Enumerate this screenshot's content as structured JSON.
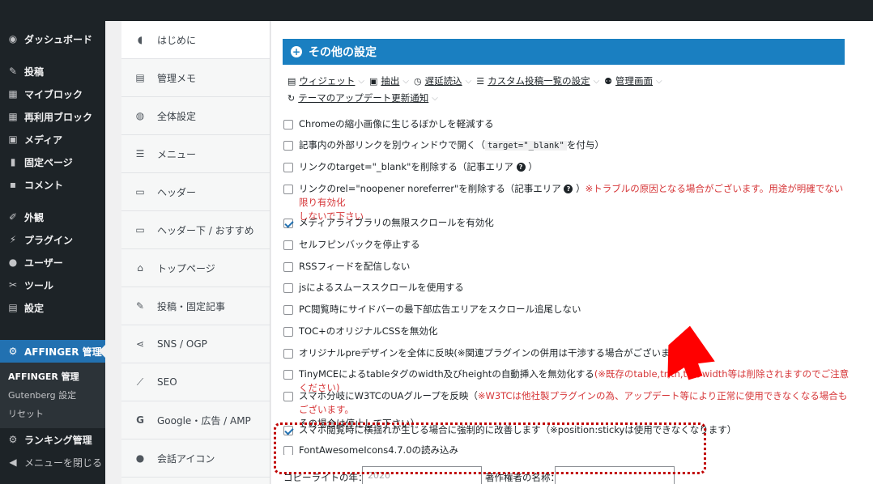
{
  "wp_menu": {
    "dashboard": "ダッシュボード",
    "posts": "投稿",
    "my_blocks": "マイブロック",
    "reusable_blocks": "再利用ブロック",
    "media": "メディア",
    "pages": "固定ページ",
    "comments": "コメント",
    "appearance": "外観",
    "plugins": "プラグイン",
    "users": "ユーザー",
    "tools": "ツール",
    "settings": "設定",
    "affinger": "AFFINGER 管理",
    "sub_affinger": "AFFINGER 管理",
    "sub_gutenberg": "Gutenberg 設定",
    "sub_reset": "リセット",
    "ranking": "ランキング管理",
    "collapse": "メニューを閉じる"
  },
  "tabs": [
    "はじめに",
    "管理メモ",
    "全体設定",
    "メニュー",
    "ヘッダー",
    "ヘッダー下 / おすすめ",
    "トップページ",
    "投稿・固定記事",
    "SNS / OGP",
    "SEO",
    "Google・広告 / AMP",
    "会話アイコン"
  ],
  "section": {
    "title": "その他の設定"
  },
  "subnav": {
    "widget": "ウィジェット",
    "extract": "抽出",
    "lazy": "遅延読込",
    "custom_list": "カスタム投稿一覧の設定",
    "admin_screen": "管理画面",
    "theme_update": "テーマのアップデート更新通知"
  },
  "options": {
    "o1": "Chromeの縮小画像に生じるぼかしを軽減する",
    "o2a": "記事内の外部リンクを別ウィンドウで開く（",
    "o2code": "target=\"_blank\"",
    "o2b": "を付与）",
    "o3": "リンクのtarget=\"_blank\"を削除する（記事エリア",
    "o3end": "）",
    "o4": "リンクのrel=\"noopener noreferrer\"を削除する（記事エリア",
    "o4end": "）",
    "o4warn1": "※トラブルの原因となる場合がございます。用途が明確でない限り有効化",
    "o4warn2": "しないで下さい",
    "o5": "メディアライブラリの無限スクロールを有効化",
    "o6": "セルフピンバックを停止する",
    "o7": "RSSフィードを配信しない",
    "o8": "jsによるスムーススクロールを使用する",
    "o9": "PC閲覧時にサイドバーの最下部広告エリアをスクロール追尾しない",
    "o10": "TOC+のオリジナルCSSを無効化",
    "o11": "オリジナルpreデザインを全体に反映(※関連プラグインの併用は干渉する場合がございます)",
    "o12": "TinyMCEによるtableタグのwidth及びheightの自動挿入を無効化する",
    "o12warn": "(※既存のtable,tr,th,tdのwidth等は削除されますのでご注意ください)",
    "o13": "スマホ分岐にW3TCのUAグループを反映（",
    "o13warn": "※W3TCは他社製プラグインの為、アップデート等により正常に使用できなくなる場合もございます。",
    "o13b": "その場合は停止して下さい）",
    "o14": "スマホ閲覧時に横揺れが生じる場合に強制的に改善します（※position:stickyは使用できなくなります）",
    "o15": "FontAwesomeIcons4.7.0の読み込み"
  },
  "fields": {
    "copyright_label": "コピーライトの年：",
    "copyright_placeholder": "2020",
    "author_label": "著作権者の名称："
  }
}
